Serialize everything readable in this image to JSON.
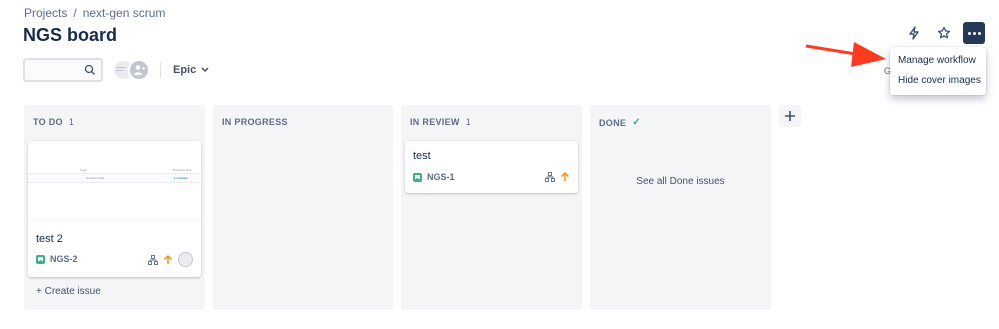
{
  "breadcrumb": {
    "projects": "Projects",
    "separator": "/",
    "project": "next-gen scrum"
  },
  "page_title": "NGS board",
  "menu": {
    "items": [
      "Manage workflow",
      "Hide cover images"
    ]
  },
  "filters": {
    "search_placeholder": "",
    "epic_label": "Epic",
    "group_label_partial": "G"
  },
  "columns": [
    {
      "name": "TO DO",
      "count": "1"
    },
    {
      "name": "IN PROGRESS",
      "count": ""
    },
    {
      "name": "IN REVIEW",
      "count": "1"
    },
    {
      "name": "DONE",
      "count": ""
    }
  ],
  "cards": [
    {
      "title": "test 2",
      "key": "NGS-2"
    },
    {
      "title": "test",
      "key": "NGS-1"
    }
  ],
  "create_issue": "+ Create issue",
  "see_all_done": "See all Done issues",
  "cover_text": {
    "type": "Type",
    "value": "Number Field",
    "col2": "Business and contacts",
    "col2_value": "1 contacts"
  },
  "colors": {
    "accent": "#253858",
    "arrow": "#ff3b1f",
    "story": "#36b37e",
    "priority": "#ff8b00",
    "column_bg": "#f4f5f7"
  }
}
